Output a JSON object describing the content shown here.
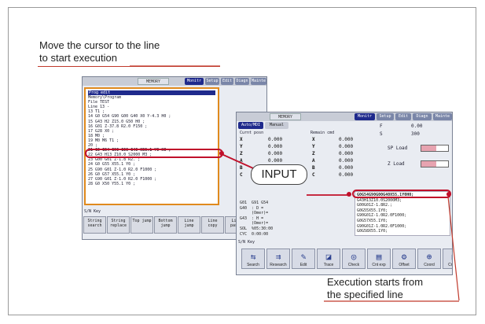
{
  "captions": {
    "top_line1": "Move the cursor to the line",
    "top_line2": "to start execution",
    "bottom_line1": "Execution starts from",
    "bottom_line2": "the specified line",
    "input_button": "INPUT"
  },
  "colors": {
    "accent_red": "#c0102a",
    "cnc_blue": "#1f2a8c",
    "edit_border": "#e08a1e"
  },
  "screen1": {
    "memory_label": "MEMORY",
    "tabs": [
      "Monitr",
      "Setup",
      "Edit",
      "Diagn",
      "Mainte"
    ],
    "edit_title": "Prog edit",
    "lines": [
      "Memory\\Program",
      "File  TEST",
      "Line  13 -",
      "13 T1 ;",
      "14 G0 G54 G90 G00 G40 X0 Y-4.3 H0 ;",
      "15 G43 H2 Z15.0 G50 H0 ;",
      "16 G01 Z-37.8 R2.0 F150 ;",
      "17 G28 X0 ;",
      "18 M0 ;",
      "19 M0 M6 T1 ;",
      "20 ;",
      "21 G0 G54 G90 G00 G40 X55.1 Y0 H0 ;",
      "22 G43 H13 Z10.0 S2000 M3 ;",
      "23 G00 G01 Z-1.8 R2. ;",
      "24 G0 G55 X55.1 Y0 ;",
      "25 G90 G01 Z-1.0 R2.0 F1000 ;",
      "26 G0 G57 X55.1 Y0 ;",
      "27 G90 G01 Z-1.0 R2.0 F1000 ;",
      "28 G0 X50 Y55.1 Y0 ;"
    ],
    "highlight_index": 11,
    "sn_key": "S/N Key",
    "softkeys": [
      "String search",
      "String replace",
      "Top jump",
      "Bottom jump",
      "Line jump",
      "Line copy",
      "Line paste",
      "Li"
    ]
  },
  "screen2": {
    "memory_label": "MEMORY",
    "tabs": [
      "Monitr",
      "Setup",
      "Edit",
      "Diagn",
      "Mainte"
    ],
    "mode_tabs": [
      "Auto/MDI",
      "Manual"
    ],
    "col_titles": [
      "Curnt posn",
      "Remain cmd"
    ],
    "axes": [
      {
        "name": "X",
        "posn": "0.000",
        "remain": "0.000"
      },
      {
        "name": "Y",
        "posn": "0.000",
        "remain": "0.000"
      },
      {
        "name": "Z",
        "posn": "0.000",
        "remain": "0.000"
      },
      {
        "name": "A",
        "posn": "0.000",
        "remain": "0.000"
      },
      {
        "name": "B",
        "posn": "0.000",
        "remain": "0.000"
      },
      {
        "name": "C",
        "posn": "0.000",
        "remain": "0.000"
      }
    ],
    "feed": {
      "f_label": "F",
      "f_value": "0.00",
      "s_label": "S",
      "s_value": "300"
    },
    "load_labels": [
      "SP Load",
      "Z Load"
    ],
    "load_levels": [
      0.55,
      0.55
    ],
    "modal": [
      "G01  G91 G54",
      "G40  : D =",
      "     (Omer)=",
      "G43  : H =",
      "     (Omer)=",
      "SOL  %05:30:00",
      "CYC  0:00:00"
    ],
    "program_lines": [
      "G0G54G90G00G40X55.1Y0H0;",
      "G43H13Z10.0S2000M3;",
      "G00G01Z-1.8R2.;",
      "G0G55X55.1Y0;",
      "G90G01Z-1.0R2.0F1000;",
      "G0G57X55.1Y0;",
      "G90G01Z-1.0R2.0F1000;",
      "G0G58X55.1Y0;"
    ],
    "sn_key": "S/N Key",
    "icons": [
      {
        "label": "Search",
        "glyph": "⇆"
      },
      {
        "label": "Research",
        "glyph": "⇉"
      },
      {
        "label": "Edit",
        "glyph": "✎"
      },
      {
        "label": "Trace",
        "glyph": "◪"
      },
      {
        "label": "Check",
        "glyph": "◎"
      },
      {
        "label": "Cnt exp",
        "glyph": "▤"
      },
      {
        "label": "Offset",
        "glyph": "⚙"
      },
      {
        "label": "Coord",
        "glyph": "⊕"
      },
      {
        "label": "Cnt set",
        "glyph": "▦"
      },
      {
        "label": "MST",
        "glyph": "◔"
      }
    ]
  }
}
